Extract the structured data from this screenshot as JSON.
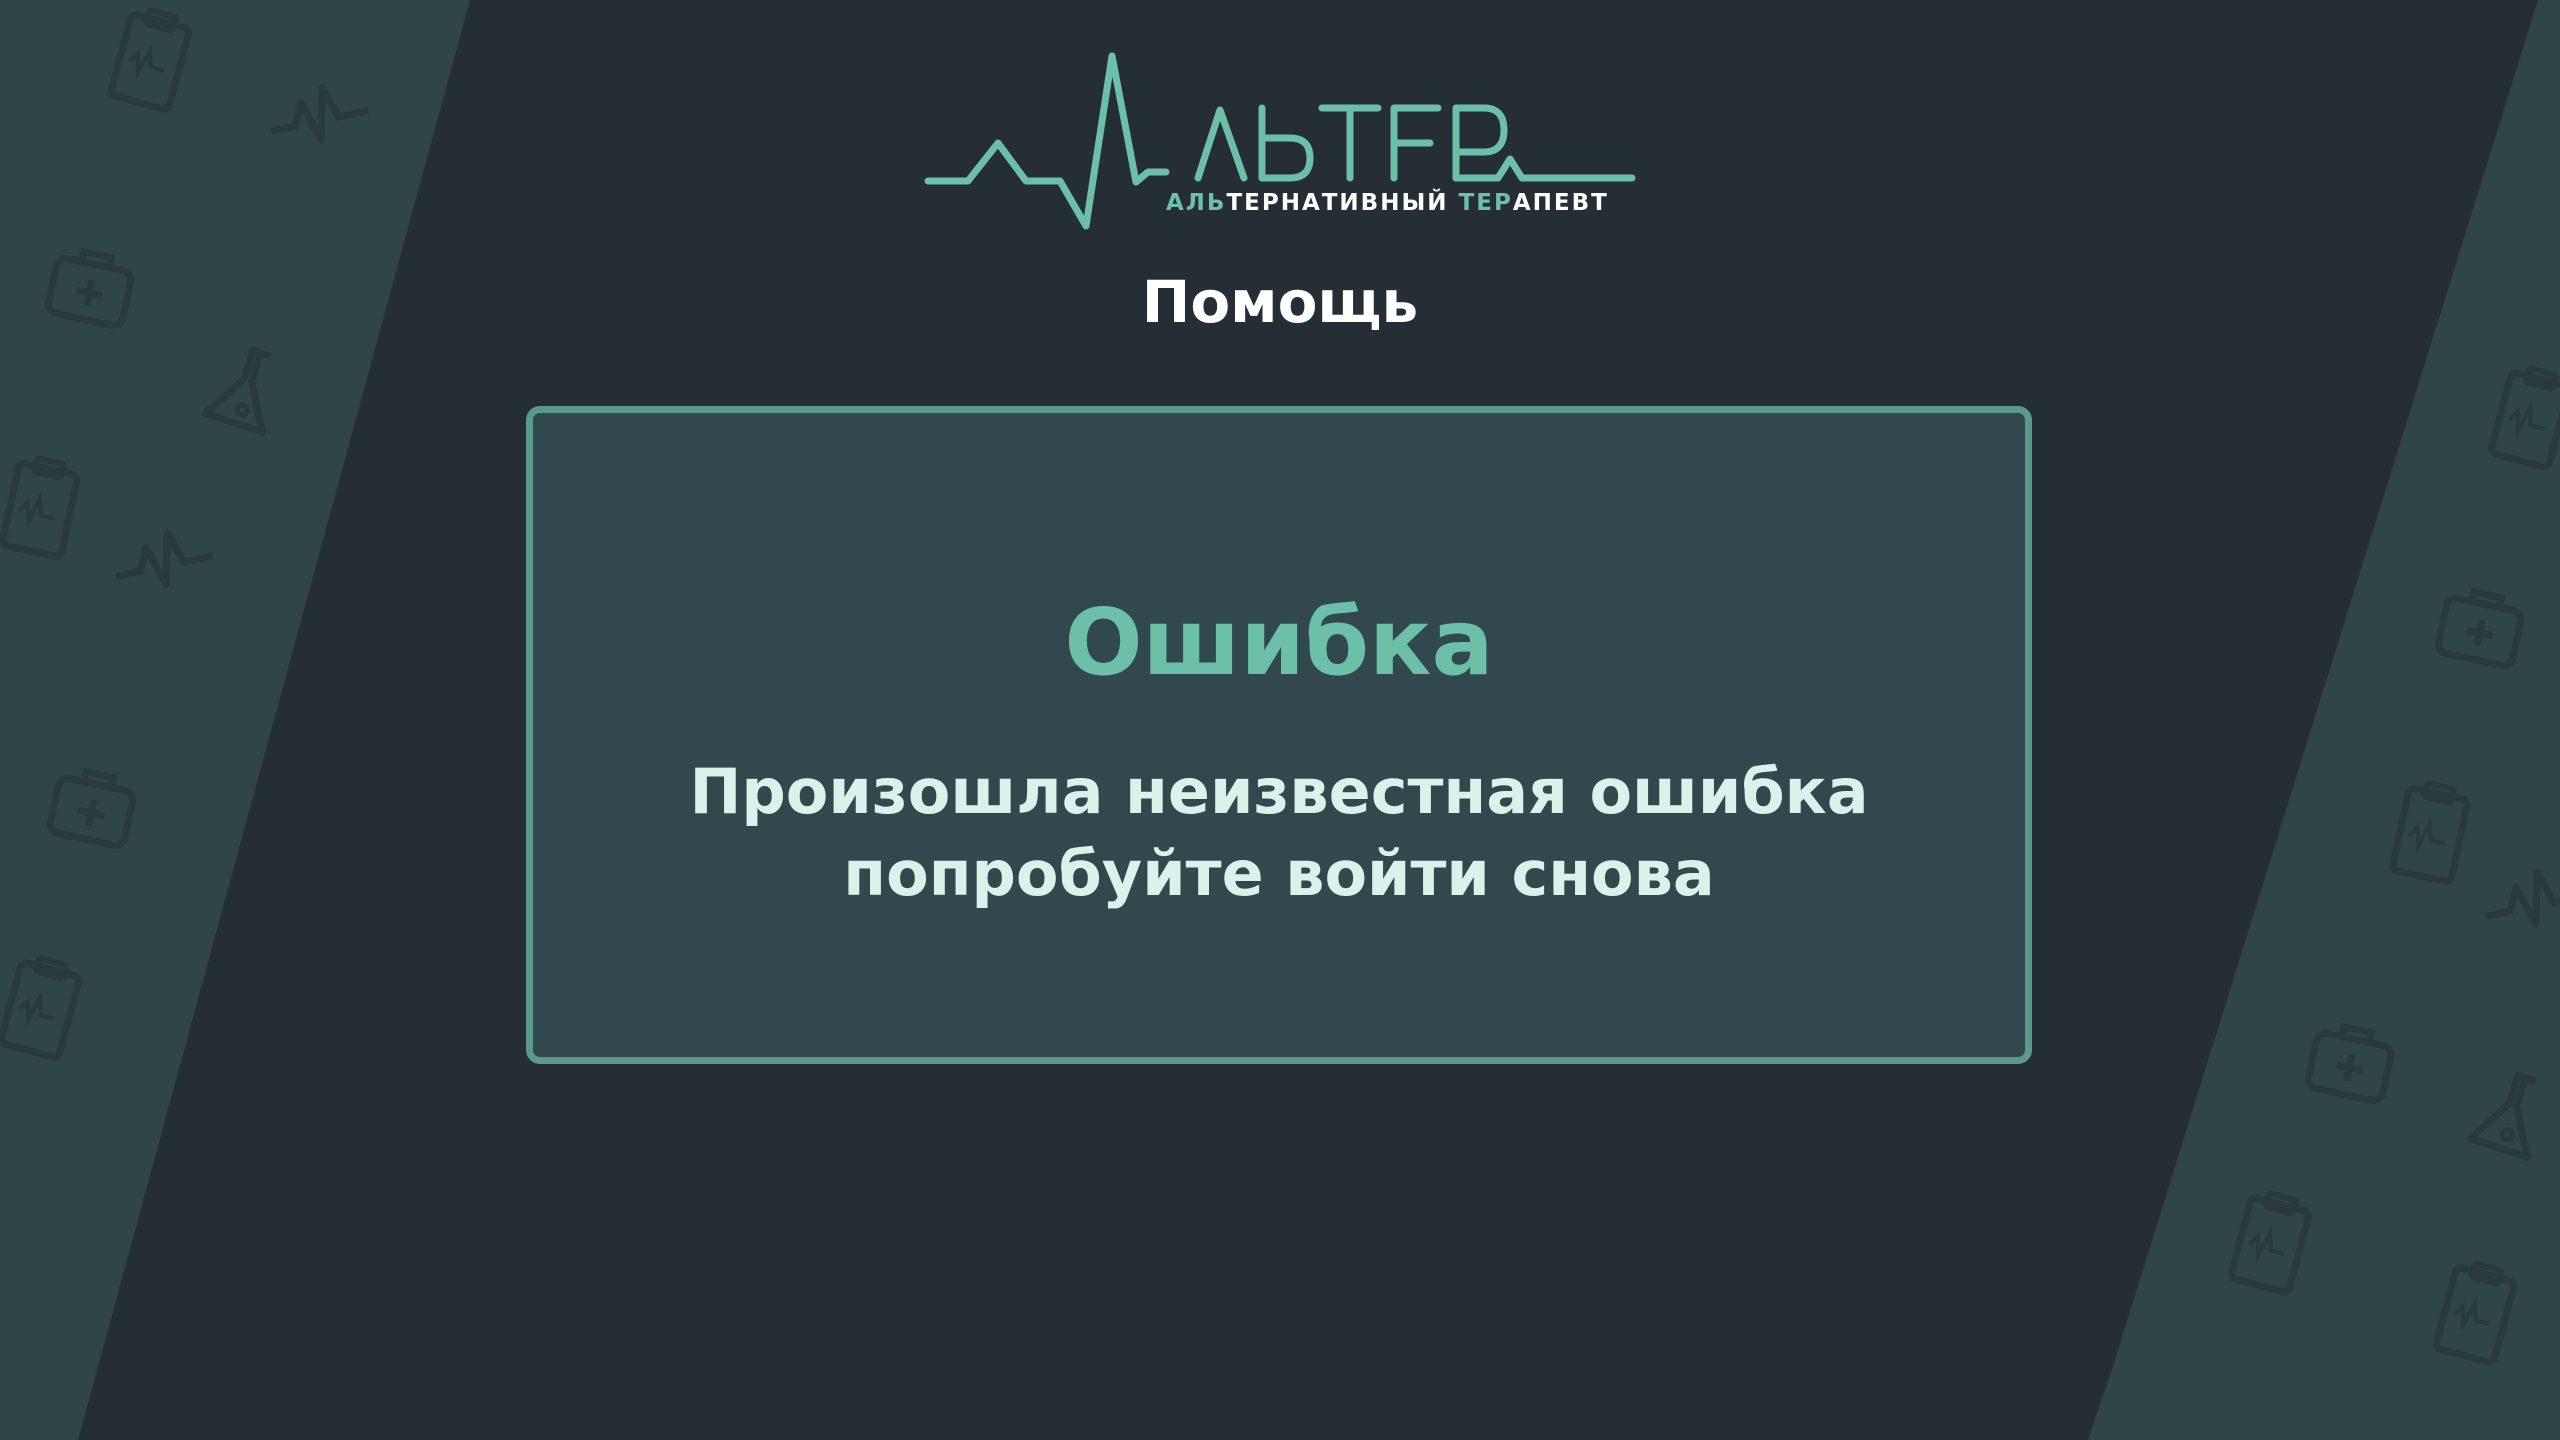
{
  "app": {
    "logo_text": "АЛЬТЕР",
    "tagline_parts": [
      {
        "text": "АЛЬ",
        "accent": true
      },
      {
        "text": "ТЕРНАТИВНЫЙ ",
        "accent": false
      },
      {
        "text": "ТЕР",
        "accent": true
      },
      {
        "text": "АПЕВТ",
        "accent": false
      }
    ]
  },
  "page": {
    "title": "Помощь"
  },
  "error": {
    "title": "Ошибка",
    "message_line1": "Произошла неизвестная ошибка",
    "message_line2": "попробуйте войти снова"
  },
  "theme": {
    "background": "#252e35",
    "panel": "#31494d",
    "accent": "#6cc0a8",
    "border": "#5b9a8b",
    "text_light": "#d9f2ea"
  },
  "decor_icons": [
    "first-aid-kit-icon",
    "heartbeat-icon",
    "flask-icon",
    "clipboard-icon"
  ]
}
